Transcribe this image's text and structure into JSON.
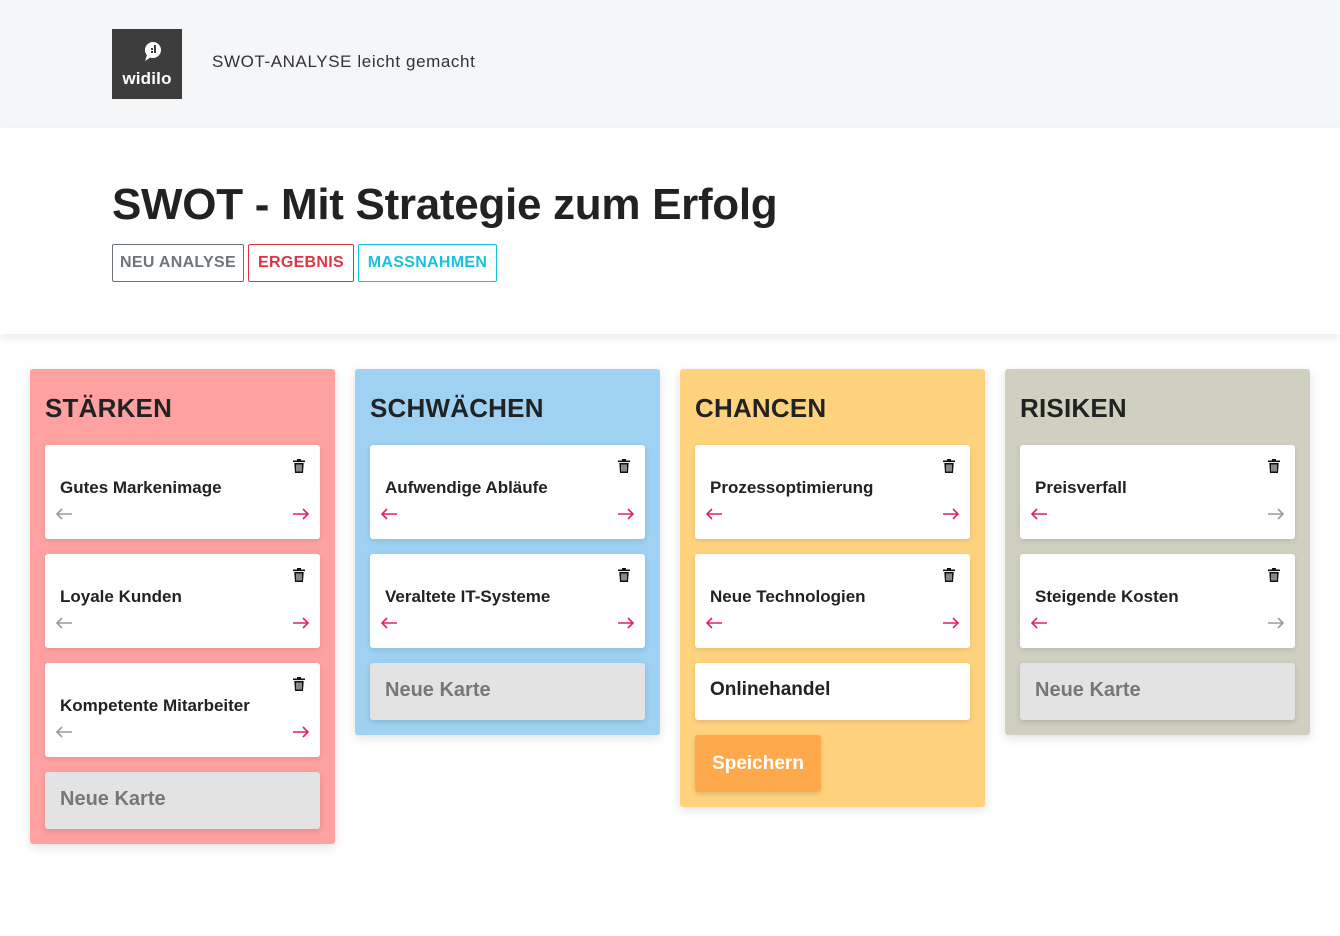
{
  "brand": {
    "logo_text": "widilo",
    "tagline": "SWOT-ANALYSE leicht gemacht"
  },
  "hero": {
    "title": "SWOT - Mit Strategie zum Erfolg",
    "buttons": {
      "new_analysis": "NEU ANALYSE",
      "result": "ERGEBNIS",
      "measures": "MASSNAHMEN"
    }
  },
  "colors": {
    "strengths": "#ffa1a1",
    "weaknesses": "#9ed1f2",
    "opportunities": "#ffd37e",
    "threats": "#d0d0c0",
    "arrow_active": "#e0245e",
    "arrow_inactive": "#9a9a9a",
    "save_button": "#ffa94d"
  },
  "columns": [
    {
      "title": "STÄRKEN",
      "cards": [
        {
          "label": "Gutes Markenimage",
          "left_arrow": "inactive",
          "right_arrow": "active"
        },
        {
          "label": "Loyale Kunden",
          "left_arrow": "inactive",
          "right_arrow": "active"
        },
        {
          "label": "Kompetente Mitarbeiter",
          "left_arrow": "inactive",
          "right_arrow": "active"
        }
      ],
      "new_card_label": "Neue Karte"
    },
    {
      "title": "SCHWÄCHEN",
      "cards": [
        {
          "label": "Aufwendige Abläufe",
          "left_arrow": "active",
          "right_arrow": "active"
        },
        {
          "label": "Veraltete IT-Systeme",
          "left_arrow": "active",
          "right_arrow": "active"
        }
      ],
      "new_card_label": "Neue Karte"
    },
    {
      "title": "CHANCEN",
      "cards": [
        {
          "label": "Prozessoptimierung",
          "left_arrow": "active",
          "right_arrow": "active"
        },
        {
          "label": "Neue Technologien",
          "left_arrow": "active",
          "right_arrow": "active"
        }
      ],
      "edit_card_value": "Onlinehandel",
      "save_label": "Speichern"
    },
    {
      "title": "RISIKEN",
      "cards": [
        {
          "label": "Preisverfall",
          "left_arrow": "active",
          "right_arrow": "inactive"
        },
        {
          "label": "Steigende Kosten",
          "left_arrow": "active",
          "right_arrow": "inactive"
        }
      ],
      "new_card_label": "Neue Karte"
    }
  ]
}
